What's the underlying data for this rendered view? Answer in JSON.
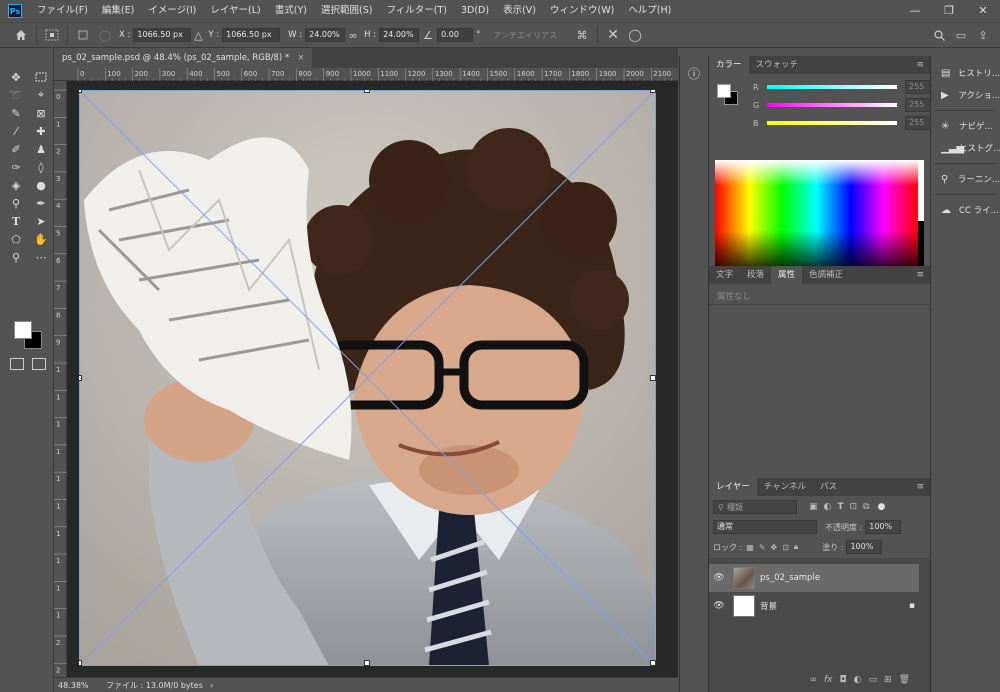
{
  "app": {
    "logo": "Ps",
    "brand_color": "#31a8ff"
  },
  "menu": [
    "ファイル(F)",
    "編集(E)",
    "イメージ(I)",
    "レイヤー(L)",
    "書式(Y)",
    "選択範囲(S)",
    "フィルター(T)",
    "3D(D)",
    "表示(V)",
    "ウィンドウ(W)",
    "ヘルプ(H)"
  ],
  "window_controls": [
    "—",
    "❐",
    "✕"
  ],
  "options": {
    "x_label": "X :",
    "x_value": "1066.50 px",
    "y_label": "Y :",
    "y_value": "1066.50 px",
    "w_label": "W :",
    "w_value": "24.00%",
    "h_label": "H :",
    "h_value": "24.00%",
    "angle_value": "0.00",
    "angle_unit": "°",
    "antialias": "アンチエイリアス"
  },
  "document": {
    "tab_title": "ps_02_sample.psd @ 48.4% (ps_02_sample, RGB/8) *",
    "close": "×",
    "zoom": "48.38%",
    "file_info": "ファイル : 13.0M/0 bytes"
  },
  "ruler_h_ticks": [
    "0",
    "100",
    "200",
    "300",
    "400",
    "500",
    "600",
    "700",
    "800",
    "900",
    "1000",
    "1100",
    "1200",
    "1300",
    "1400",
    "1500",
    "1600",
    "1700",
    "1800",
    "1900",
    "2000",
    "2100"
  ],
  "ruler_v_ticks": [
    "0",
    "1",
    "2",
    "3",
    "4",
    "5",
    "6",
    "7",
    "8",
    "9",
    "1",
    "1",
    "1",
    "1",
    "1",
    "1",
    "1",
    "1",
    "1",
    "1",
    "2",
    "2"
  ],
  "color_panel": {
    "tabs": [
      "カラー",
      "スウォッチ"
    ],
    "channels": [
      {
        "label": "R",
        "value": "255",
        "gradient_from": "#00ffff",
        "gradient_to": "#ffffff"
      },
      {
        "label": "G",
        "value": "255",
        "gradient_from": "#ff00ff",
        "gradient_to": "#ffffff"
      },
      {
        "label": "B",
        "value": "255",
        "gradient_from": "#ffff00",
        "gradient_to": "#ffffff"
      }
    ]
  },
  "properties_panel": {
    "tabs": [
      "文字",
      "段落",
      "属性",
      "色調補正"
    ],
    "empty_text": "属性なし"
  },
  "layers_panel": {
    "tabs": [
      "レイヤー",
      "チャンネル",
      "パス"
    ],
    "filter_placeholder": "種類",
    "blend_mode": "通常",
    "opacity_label": "不透明度 :",
    "opacity_value": "100%",
    "lock_label": "ロック :",
    "fill_label": "塗り :",
    "fill_value": "100%",
    "layers": [
      {
        "name": "ps_02_sample",
        "selected": true,
        "locked": false
      },
      {
        "name": "背景",
        "selected": false,
        "locked": true
      }
    ],
    "footer_icons": [
      "link-icon",
      "fx-icon",
      "mask-icon",
      "adjustment-icon",
      "group-icon",
      "new-layer-icon",
      "trash-icon"
    ]
  },
  "right_strip": [
    {
      "icon": "history-icon",
      "label": "ヒストリ..."
    },
    {
      "icon": "play-icon",
      "label": "アクショ..."
    },
    {
      "icon": "navigator-icon",
      "label": "ナビゲ..."
    },
    {
      "icon": "histogram-icon",
      "label": "ヒストグ..."
    },
    {
      "icon": "bulb-icon",
      "label": "ラーニン..."
    },
    {
      "icon": "cc-icon",
      "label": "CC ライ..."
    }
  ],
  "collapsed_strip": [
    {
      "icon": "info-icon",
      "label": "ⓘ"
    }
  ]
}
